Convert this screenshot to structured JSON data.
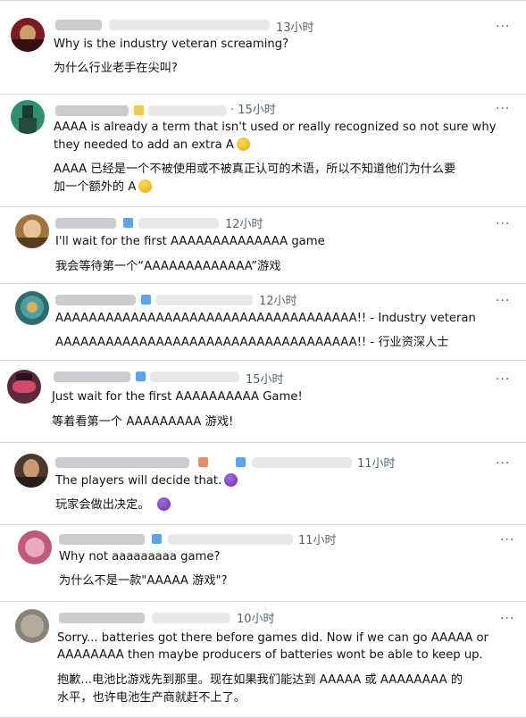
{
  "comments": [
    {
      "time": "13小时",
      "text1": "Why is the industry veteran screaming?",
      "text2": "为什么行业老手在尖叫?",
      "avatar_color": "#7a1a22"
    },
    {
      "time": "· 15小时",
      "text1a": "AAAA is already a term that isn't used or really recognized so not sure why",
      "text1b": "they needed to add an extra A",
      "text2a": "AAAA 已经是一个不被使用或不被真正认可的术语，所以不知道他们为什么要",
      "text2b": "加一个额外的 A",
      "emoji": "thinking-face",
      "avatar_color": "#2f8f73"
    },
    {
      "time": "12小时",
      "text1": "I'll wait for the first AAAAAAAAAAAAAA game",
      "text2": "我会等待第一个“AAAAAAAAAAAAA”游戏",
      "avatar_color": "#a0733f"
    },
    {
      "time": "12小时",
      "text1": "AAAAAAAAAAAAAAAAAAAAAAAAAAAAAAAAAAAA!! - Industry veteran",
      "text2": "AAAAAAAAAAAAAAAAAAAAAAAAAAAAAAAAAAAA!! - 行业资深人士",
      "avatar_color": "#2e6b6b"
    },
    {
      "time": "15小时",
      "text1": "Just wait for the first AAAAAAAAAA Game!",
      "text2": "等着看第一个 AAAAAAAAA 游戏!",
      "avatar_color": "#5a2a3a"
    },
    {
      "time": "11小时",
      "text1": "The players will decide that.",
      "text2": "玩家会做出决定。",
      "emoji": "smiling-face-with-horns",
      "avatar_color": "#4a3a2e"
    },
    {
      "time": "11小时",
      "text1": "Why not aaaaaaaaa game?",
      "text2": "为什么不是一款\"AAAAA 游戏\"?",
      "avatar_color": "#c05a7a"
    },
    {
      "time": "10小时",
      "text1a": "Sorry... batteries got there before games did. Now if we can go AAAAA or",
      "text1b": "AAAAAAAA then maybe producers of batteries wont be able to keep up.",
      "text2a": "抱歉...电池比游戏先到那里。现在如果我们能达到 AAAAA 或 AAAAAAAA 的",
      "text2b": "水平，也许电池生产商就赶不上了。",
      "avatar_color": "#8a8276"
    }
  ],
  "more_label": "···"
}
